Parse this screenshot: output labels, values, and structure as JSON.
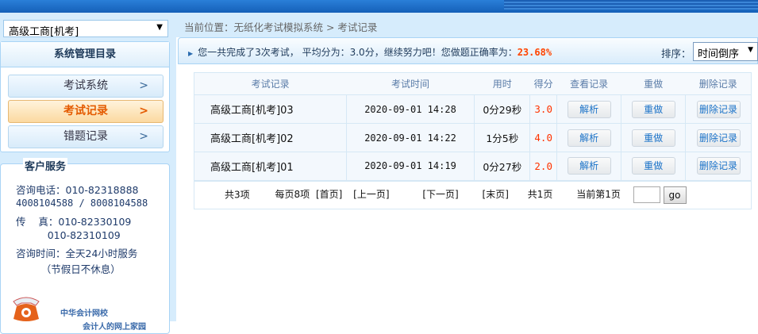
{
  "sidebar": {
    "course_select": "高级工商[机考]",
    "panel_title": "系统管理目录",
    "menu": [
      {
        "label": "考试系统"
      },
      {
        "label": "考试记录",
        "active": true
      },
      {
        "label": "错题记录"
      }
    ],
    "service": {
      "title": "客户服务",
      "lines": [
        "咨询电话：010-82318888",
        "4008104588 / 8008104588",
        "传    真：010-82330109",
        "          010-82310109",
        "咨询时间：全天24小时服务",
        "        （节假日不休息）"
      ],
      "logo_line1": "中华会计网校",
      "logo_line2": "会计人的网上家园"
    }
  },
  "main": {
    "breadcrumb": "当前位置：无纸化考试模拟系统 > 考试记录",
    "summary_prefix": "您一共完成了3次考试，  平均分为：3.0分，继续努力吧！您做题正确率为：",
    "summary_rate": "23.68%",
    "sort_label": "排序：",
    "sort_value": "时间倒序",
    "columns": [
      "考试记录",
      "考试时间",
      "用时",
      "得分",
      "查看记录",
      "重做",
      "删除记录"
    ],
    "rows": [
      {
        "name": "高级工商[机考]03",
        "time": "2020-09-01 14:28",
        "duration": "0分29秒",
        "score": "3.0",
        "view": "解析",
        "redo": "重做",
        "delete": "删除记录"
      },
      {
        "name": "高级工商[机考]02",
        "time": "2020-09-01 14:22",
        "duration": "1分5秒",
        "score": "4.0",
        "view": "解析",
        "redo": "重做",
        "delete": "删除记录"
      },
      {
        "name": "高级工商[机考]01",
        "time": "2020-09-01 14:19",
        "duration": "0分27秒",
        "score": "2.0",
        "view": "解析",
        "redo": "重做",
        "delete": "删除记录"
      }
    ],
    "pager": {
      "total": "共3项",
      "per_page": "每页8项",
      "first": "[首页]",
      "prev": "[上一页]",
      "next": "[下一页]",
      "last": "[末页]",
      "pages": "共1页",
      "current": "当前第1页",
      "page_input": "",
      "go": "go"
    }
  },
  "colors": {
    "banner": "#1a6cc6",
    "accent": "#e45a00",
    "score": "#ff3300"
  }
}
